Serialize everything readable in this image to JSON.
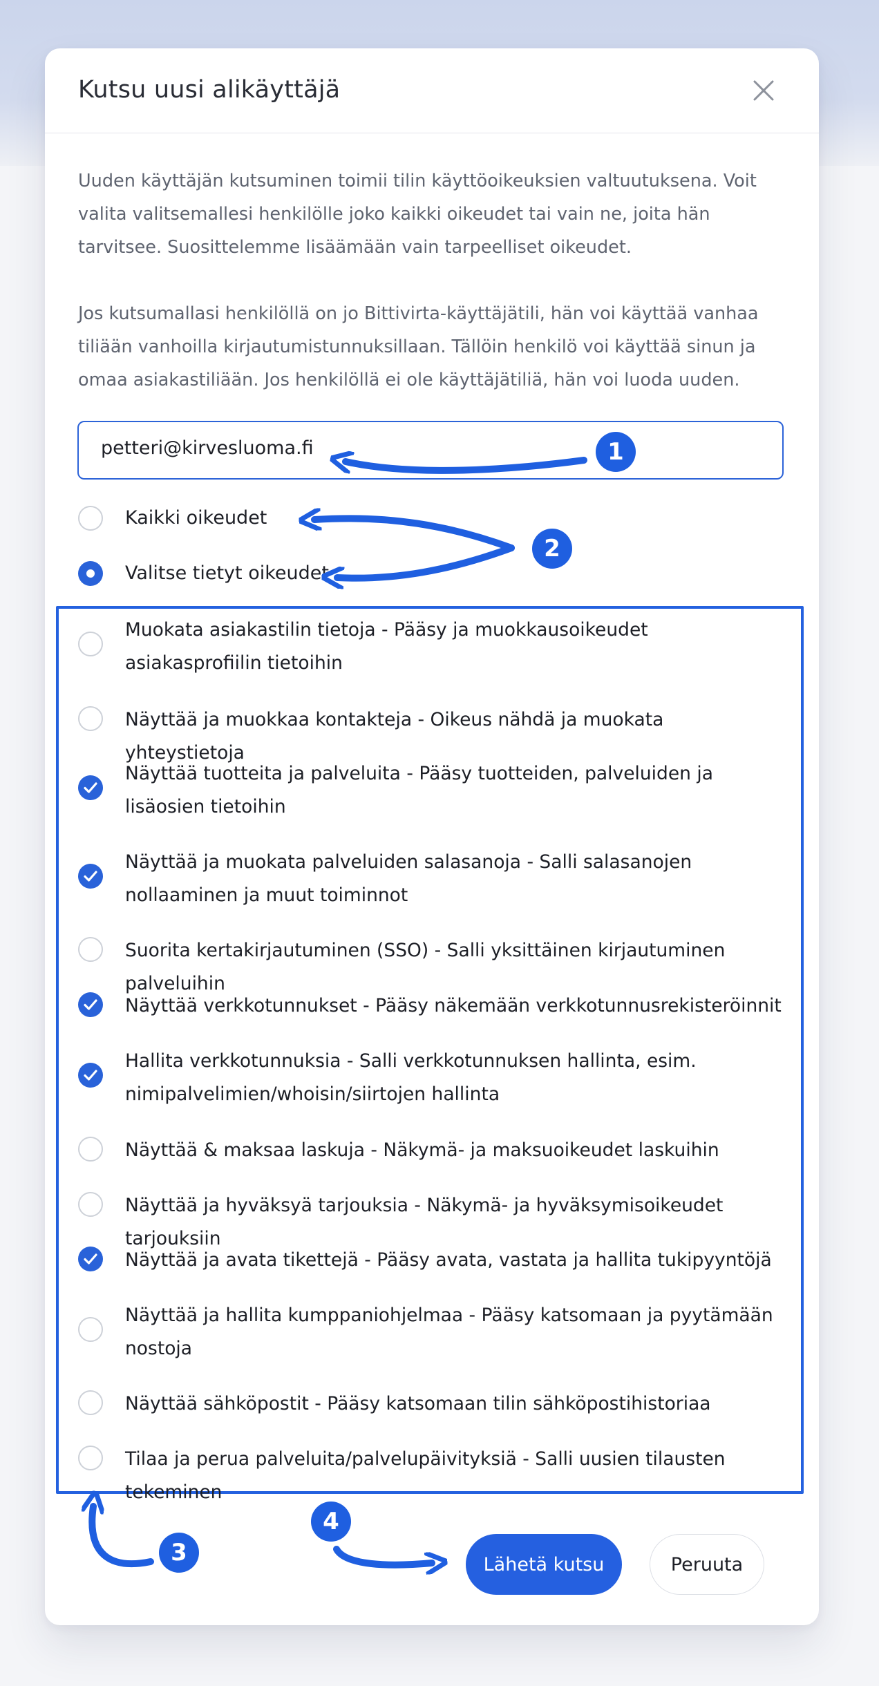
{
  "dialog": {
    "title": "Kutsu uusi alikäyttäjä",
    "intro": "Uuden käyttäjän kutsuminen toimii tilin käyttöoikeuksien valtuutuksena. Voit valita valitsemallesi henkilölle joko kaikki oikeudet tai vain ne, joita hän tarvitsee. Suosittelemme lisäämään vain tarpeelliset oikeudet.",
    "note": "Jos kutsumallasi henkilöllä on jo Bittivirta-käyttäjätili, hän voi käyttää vanhaa tiliään vanhoilla kirjautumistunnuksillaan. Tällöin henkilö voi käyttää sinun ja omaa asiakastiliään. Jos henkilöllä ei ole käyttäjätiliä, hän voi luoda uuden."
  },
  "email": {
    "value": "petteri@kirvesluoma.fi"
  },
  "access_mode": {
    "options": [
      {
        "label": "Kaikki oikeudet",
        "selected": false
      },
      {
        "label": "Valitse tietyt oikeudet",
        "selected": true
      }
    ]
  },
  "permissions": [
    {
      "label": "Muokata asiakastilin tietoja - Pääsy ja muokkausoikeudet asiakasprofiilin tietoihin",
      "checked": false
    },
    {
      "label": "Näyttää ja muokkaa kontakteja - Oikeus nähdä ja muokata yhteystietoja",
      "checked": false
    },
    {
      "label": "Näyttää tuotteita ja palveluita - Pääsy tuotteiden, palveluiden ja lisäosien tietoihin",
      "checked": true
    },
    {
      "label": "Näyttää ja muokata palveluiden salasanoja - Salli salasanojen nollaaminen ja muut toiminnot",
      "checked": true
    },
    {
      "label": "Suorita kertakirjautuminen (SSO) - Salli yksittäinen kirjautuminen palveluihin",
      "checked": false
    },
    {
      "label": "Näyttää verkkotunnukset - Pääsy näkemään verkkotunnusrekisteröinnit",
      "checked": true
    },
    {
      "label": "Hallita verkkotunnuksia - Salli verkkotunnuksen hallinta, esim. nimipalvelimien/whoisin/siirtojen hallinta",
      "checked": true
    },
    {
      "label": "Näyttää & maksaa laskuja - Näkymä- ja maksuoikeudet laskuihin",
      "checked": false
    },
    {
      "label": "Näyttää ja hyväksyä tarjouksia - Näkymä- ja hyväksymisoikeudet tarjouksiin",
      "checked": false
    },
    {
      "label": "Näyttää ja avata tikettejä - Pääsy avata, vastata ja hallita tukipyyntöjä",
      "checked": true
    },
    {
      "label": "Näyttää ja hallita kumppaniohjelmaa - Pääsy katsomaan ja pyytämään nostoja",
      "checked": false
    },
    {
      "label": "Näyttää sähköpostit - Pääsy katsomaan tilin sähköpostihistoriaa",
      "checked": false
    },
    {
      "label": "Tilaa ja perua palveluita/palvelupäivityksiä - Salli uusien tilausten tekeminen",
      "checked": false
    }
  ],
  "actions": {
    "submit_label": "Lähetä kutsu",
    "cancel_label": "Peruuta"
  },
  "annotations": {
    "badge_1": "1",
    "badge_2": "2",
    "badge_3": "3",
    "badge_4": "4"
  },
  "colors": {
    "accent": "#2560e0",
    "annotation": "#1f5fe0",
    "text": "#1d1f26",
    "muted": "#5f6470"
  },
  "icons": {
    "close": "close-icon",
    "check": "checkmark-icon"
  }
}
